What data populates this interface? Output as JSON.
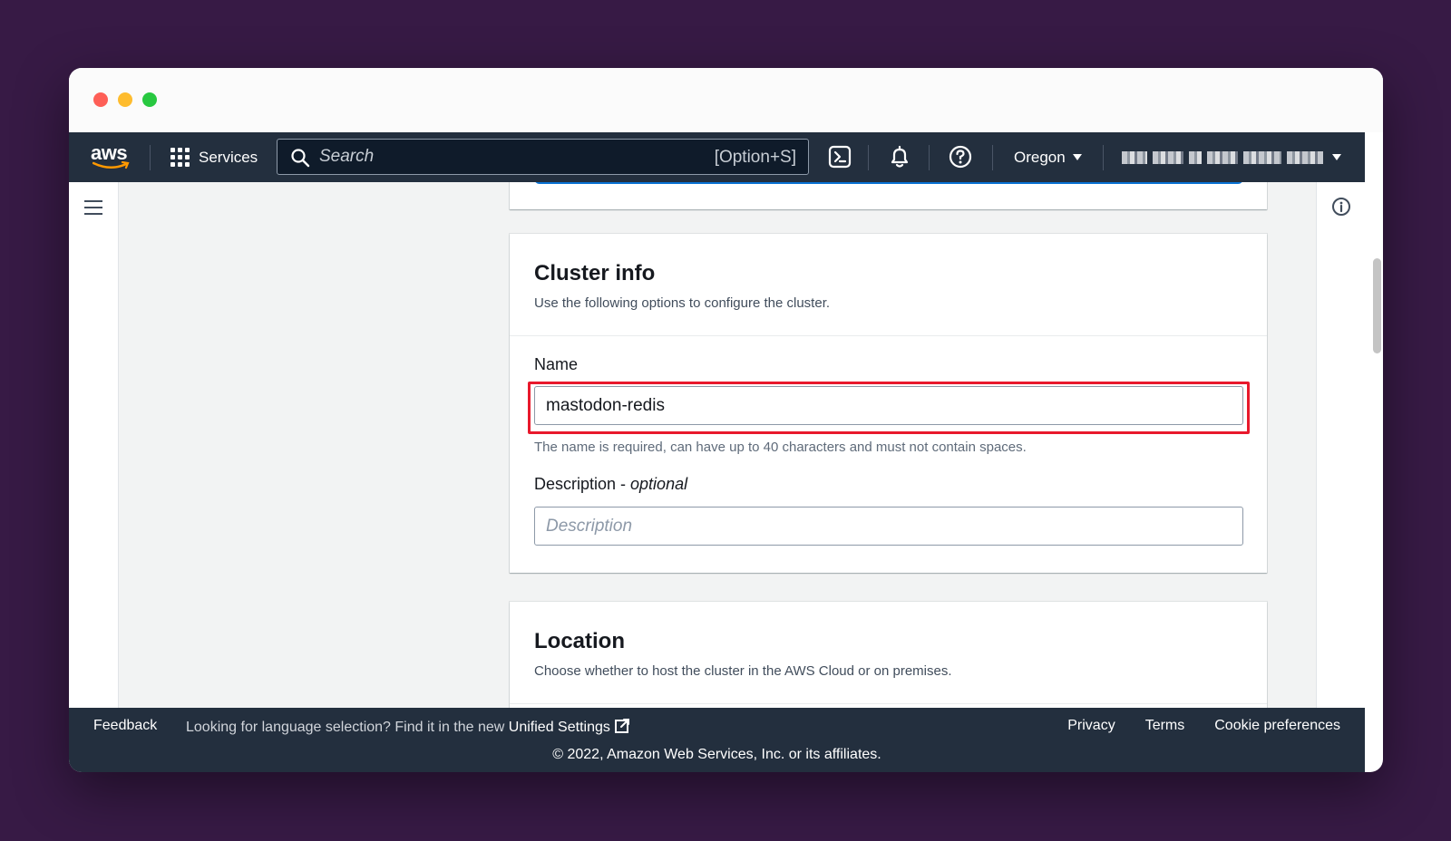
{
  "window": {
    "controls": [
      "close",
      "minimize",
      "zoom"
    ]
  },
  "navbar": {
    "logo_text": "aws",
    "services_label": "Services",
    "search_placeholder": "Search",
    "search_shortcut": "[Option+S]",
    "icons": [
      "cloudshell-icon",
      "bell-icon",
      "help-icon"
    ],
    "region_label": "Oregon"
  },
  "cluster_info": {
    "title": "Cluster info",
    "description": "Use the following options to configure the cluster.",
    "name_label": "Name",
    "name_value": "mastodon-redis",
    "name_constraint": "The name is required, can have up to 40 characters and must not contain spaces.",
    "description_label": "Description - ",
    "description_optional": "optional",
    "description_placeholder": "Description"
  },
  "location": {
    "title": "Location",
    "description": "Choose whether to host the cluster in the AWS Cloud or on premises."
  },
  "footer": {
    "feedback": "Feedback",
    "language_text": "Looking for language selection? Find it in the new ",
    "unified_settings": "Unified Settings",
    "links": {
      "privacy": "Privacy",
      "terms": "Terms",
      "cookies": "Cookie preferences"
    },
    "copyright": "© 2022, Amazon Web Services, Inc. or its affiliates."
  },
  "colors": {
    "background": "#371a45",
    "navbar": "#232f3e",
    "highlight": "#e8192c",
    "focus_blue": "#0972d3"
  }
}
